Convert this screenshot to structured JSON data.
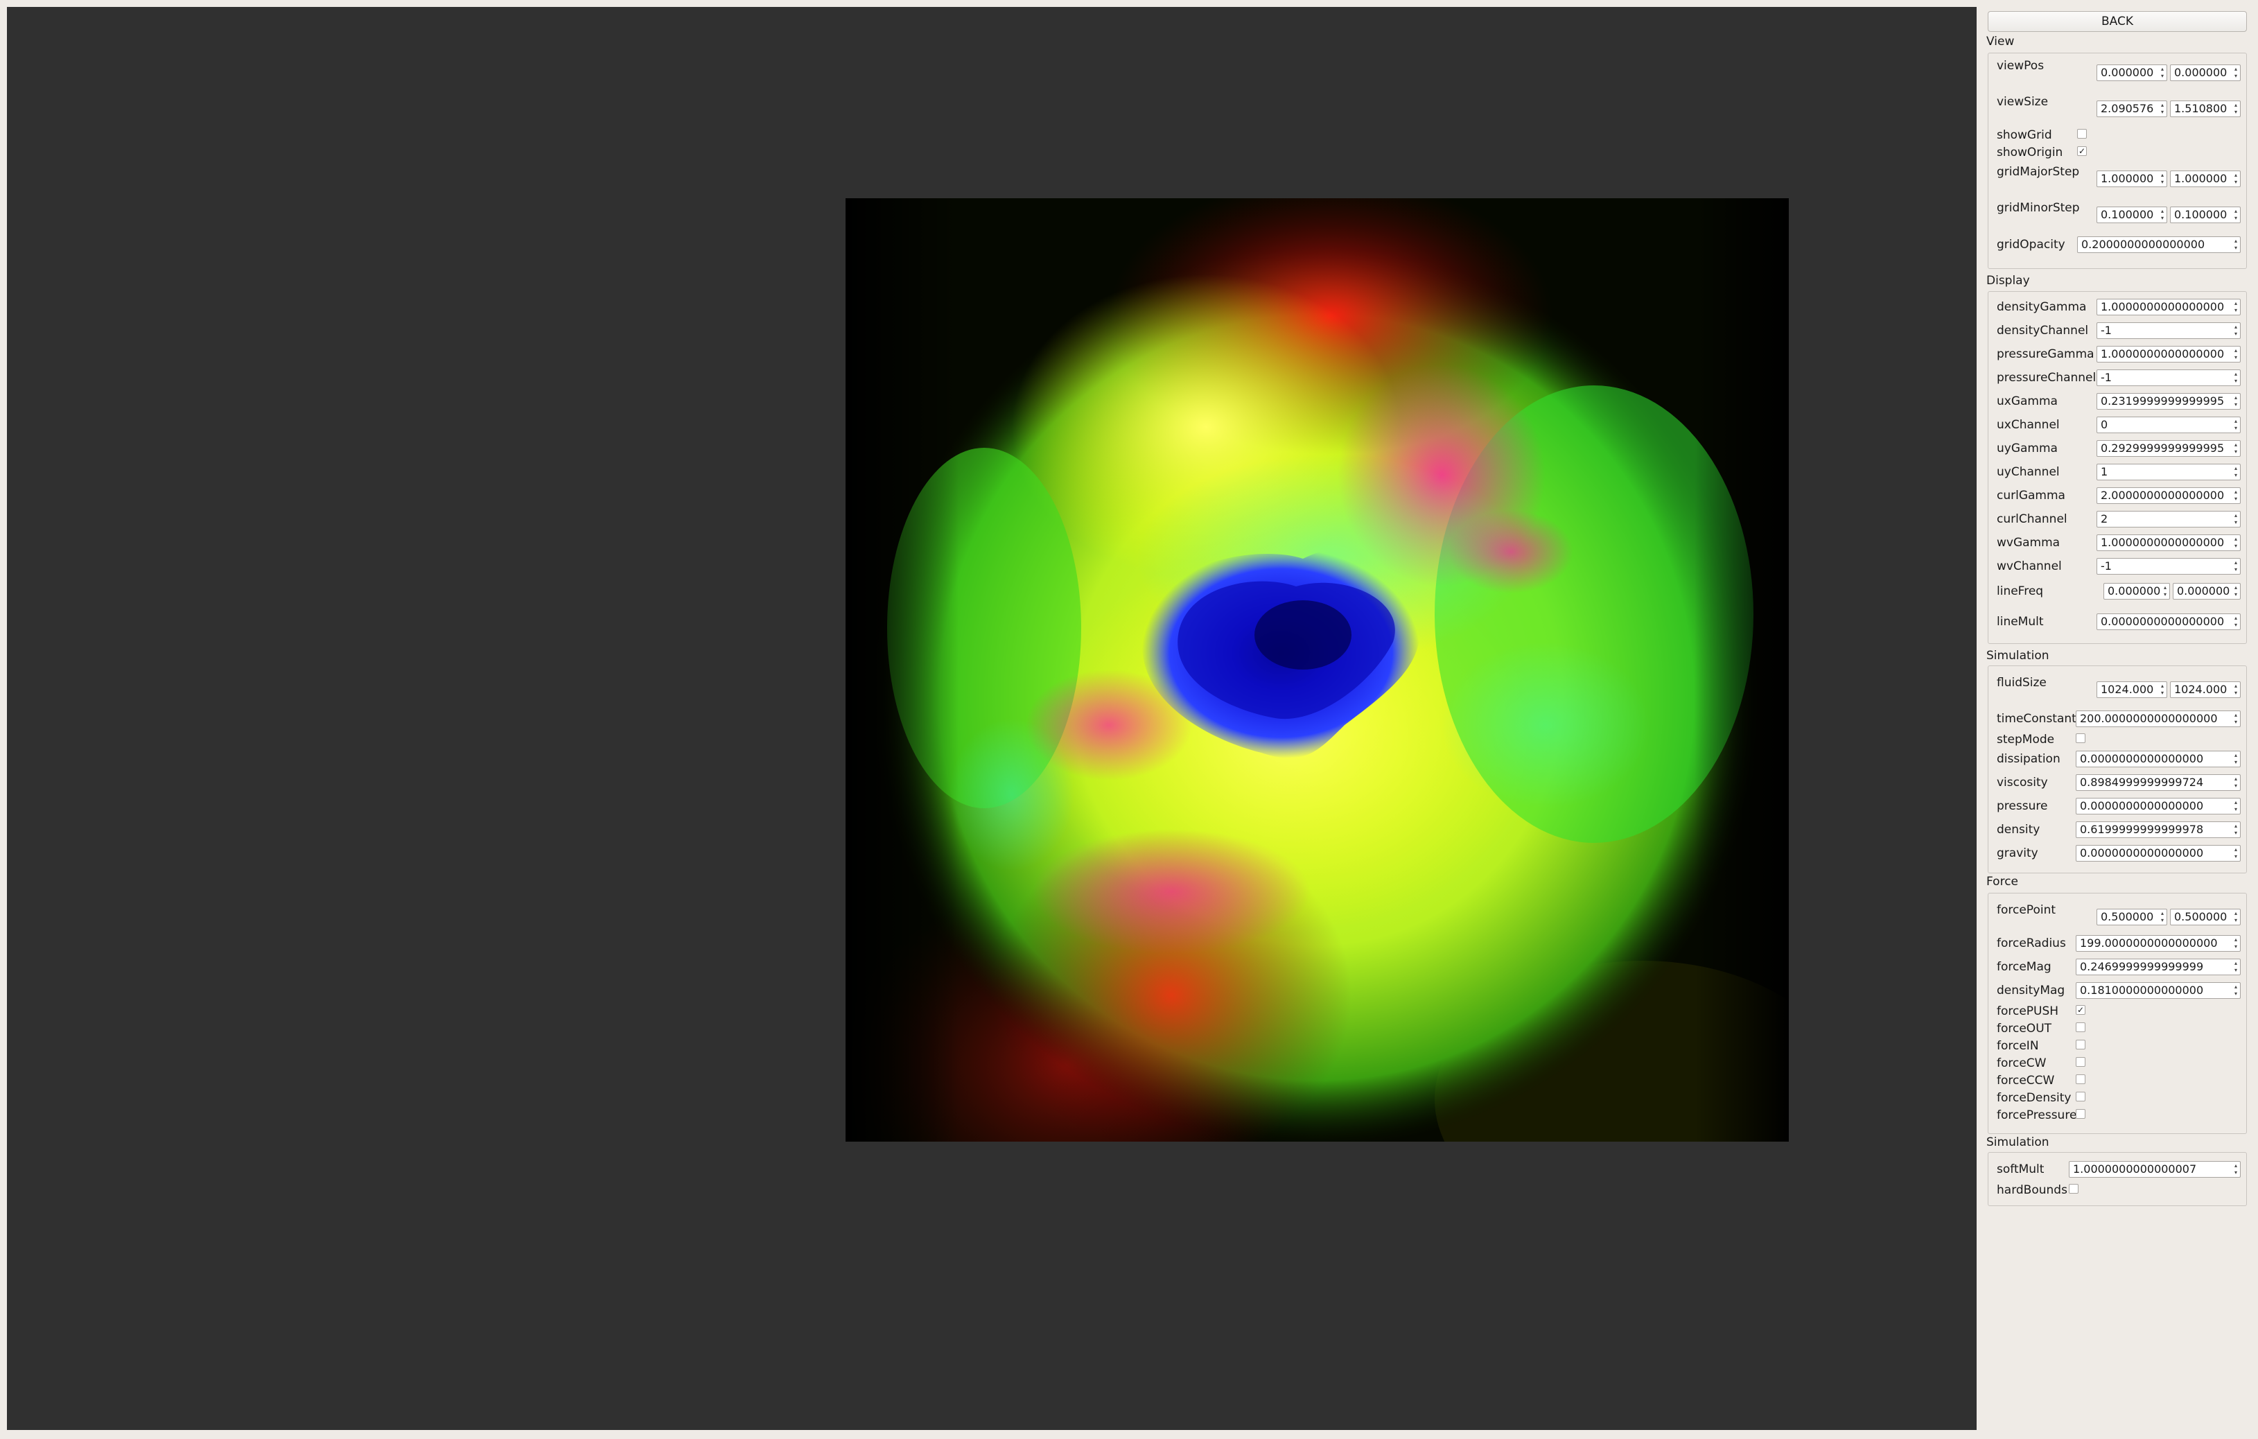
{
  "back_label": "BACK",
  "icons": {
    "spin_arrows": "spin-up-down-icon",
    "check": "checkmark-icon"
  },
  "view": {
    "title": "View",
    "viewPos": {
      "label": "viewPos",
      "x": "0.000000",
      "y": "0.000000"
    },
    "viewSize": {
      "label": "viewSize",
      "x": "2.090576",
      "y": "1.510800"
    },
    "showGrid": {
      "label": "showGrid",
      "checked": false
    },
    "showOrigin": {
      "label": "showOrigin",
      "checked": true
    },
    "gridMajorStep": {
      "label": "gridMajorStep",
      "x": "1.000000",
      "y": "1.000000"
    },
    "gridMinorStep": {
      "label": "gridMinorStep",
      "x": "0.100000",
      "y": "0.100000"
    },
    "gridOpacity": {
      "label": "gridOpacity",
      "value": "0.2000000000000000"
    }
  },
  "display": {
    "title": "Display",
    "fields": [
      {
        "label": "densityGamma",
        "value": "1.0000000000000000"
      },
      {
        "label": "densityChannel",
        "value": "-1"
      },
      {
        "label": "pressureGamma",
        "value": "1.0000000000000000"
      },
      {
        "label": "pressureChannel",
        "value": "-1"
      },
      {
        "label": "uxGamma",
        "value": "0.2319999999999995"
      },
      {
        "label": "uxChannel",
        "value": "0"
      },
      {
        "label": "uyGamma",
        "value": "0.2929999999999995"
      },
      {
        "label": "uyChannel",
        "value": "1"
      },
      {
        "label": "curlGamma",
        "value": "2.0000000000000000"
      },
      {
        "label": "curlChannel",
        "value": "2"
      },
      {
        "label": "wvGamma",
        "value": "1.0000000000000000"
      },
      {
        "label": "wvChannel",
        "value": "-1"
      }
    ],
    "lineFreq": {
      "label": "lineFreq",
      "x": "0.000000",
      "y": "0.000000"
    },
    "lineMult": {
      "label": "lineMult",
      "value": "0.0000000000000000"
    }
  },
  "simulation": {
    "title": "Simulation",
    "fluidSize": {
      "label": "fluidSize",
      "x": "1024.000",
      "y": "1024.000"
    },
    "timeConstant": {
      "label": "timeConstant",
      "value": "200.0000000000000000"
    },
    "stepMode": {
      "label": "stepMode",
      "checked": false
    },
    "fields": [
      {
        "label": "dissipation",
        "value": "0.0000000000000000"
      },
      {
        "label": "viscosity",
        "value": "0.8984999999999724"
      },
      {
        "label": "pressure",
        "value": "0.0000000000000000"
      },
      {
        "label": "density",
        "value": "0.6199999999999978"
      },
      {
        "label": "gravity",
        "value": "0.0000000000000000"
      }
    ]
  },
  "force": {
    "title": "Force",
    "forcePoint": {
      "label": "forcePoint",
      "x": "0.500000",
      "y": "0.500000"
    },
    "fields": [
      {
        "label": "forceRadius",
        "value": "199.0000000000000000"
      },
      {
        "label": "forceMag",
        "value": "0.2469999999999999"
      },
      {
        "label": "densityMag",
        "value": "0.1810000000000000"
      }
    ],
    "checks": [
      {
        "label": "forcePUSH",
        "checked": true
      },
      {
        "label": "forceOUT",
        "checked": false
      },
      {
        "label": "forceIN",
        "checked": false
      },
      {
        "label": "forceCW",
        "checked": false
      },
      {
        "label": "forceCCW",
        "checked": false
      },
      {
        "label": "forceDensity",
        "checked": false
      },
      {
        "label": "forcePressure",
        "checked": false
      }
    ]
  },
  "simulation2": {
    "title": "Simulation",
    "softMult": {
      "label": "softMult",
      "value": "1.0000000000000007"
    },
    "hardBounds": {
      "label": "hardBounds",
      "checked": false
    }
  }
}
